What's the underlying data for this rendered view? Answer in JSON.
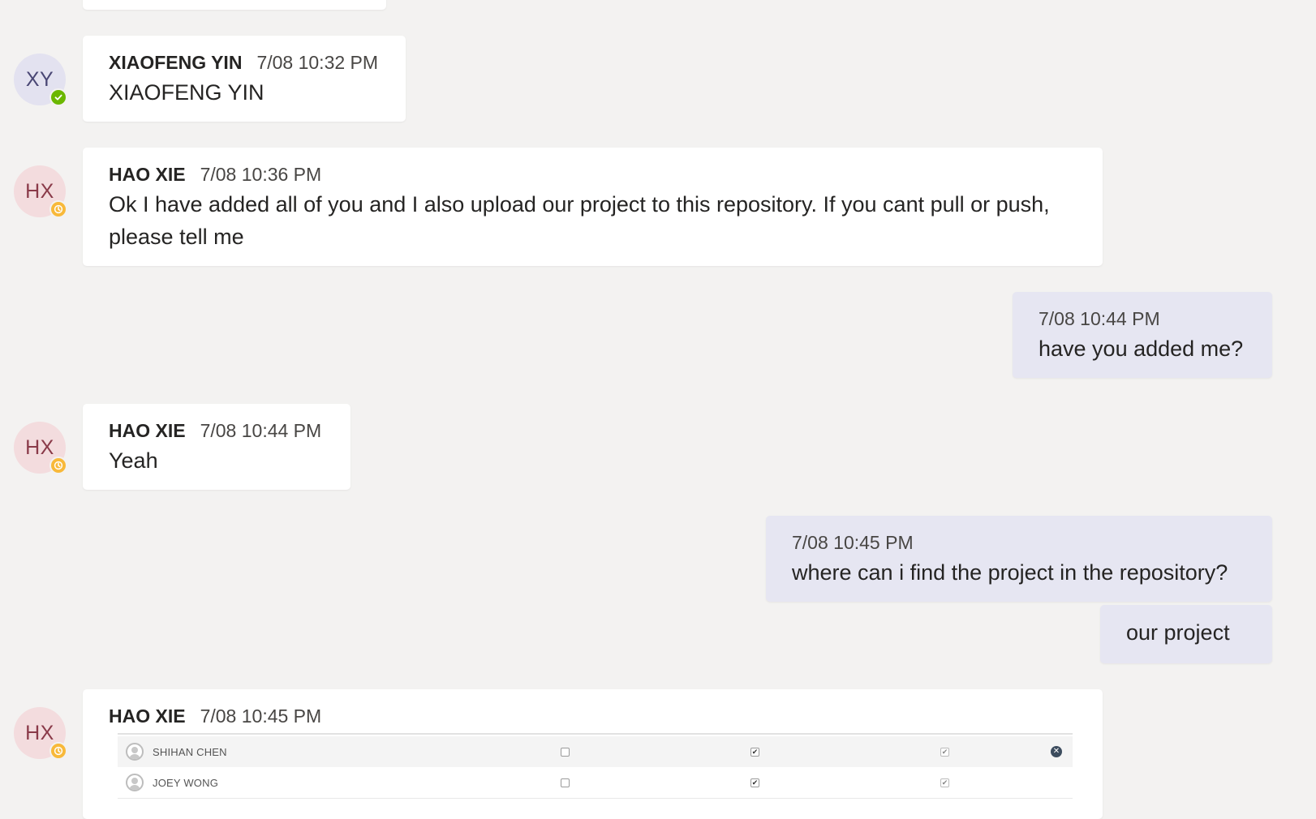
{
  "messages": [
    {
      "author": "XIAOFENG YIN",
      "time": "7/08 10:32 PM",
      "text": "XIAOFENG YIN",
      "initials": "XY"
    },
    {
      "author": "HAO XIE",
      "time": "7/08 10:36 PM",
      "text": "Ok I have added all of you and I also upload our project to this repository. If you cant pull or push, please tell me",
      "initials": "HX"
    },
    {
      "time": "7/08 10:44 PM",
      "text": "have you added me?"
    },
    {
      "author": "HAO XIE",
      "time": "7/08 10:44 PM",
      "text": "Yeah",
      "initials": "HX"
    },
    {
      "time": "7/08 10:45 PM",
      "text": "where can i find the project in the repository?"
    },
    {
      "text": "our project"
    },
    {
      "author": "HAO XIE",
      "time": "7/08 10:45 PM",
      "initials": "HX"
    }
  ],
  "shared_screenshot": {
    "rows": [
      {
        "name": "SHIHAN CHEN"
      },
      {
        "name": "JOEY WONG"
      }
    ]
  },
  "colors": {
    "background": "#f3f2f1",
    "own_message_bg": "#e6e6f2",
    "available": "#6bb700",
    "away": "#f8b93a"
  },
  "icons": {
    "available_status": "check-circle-icon",
    "away_status": "clock-icon",
    "remove": "close-circle-icon"
  }
}
